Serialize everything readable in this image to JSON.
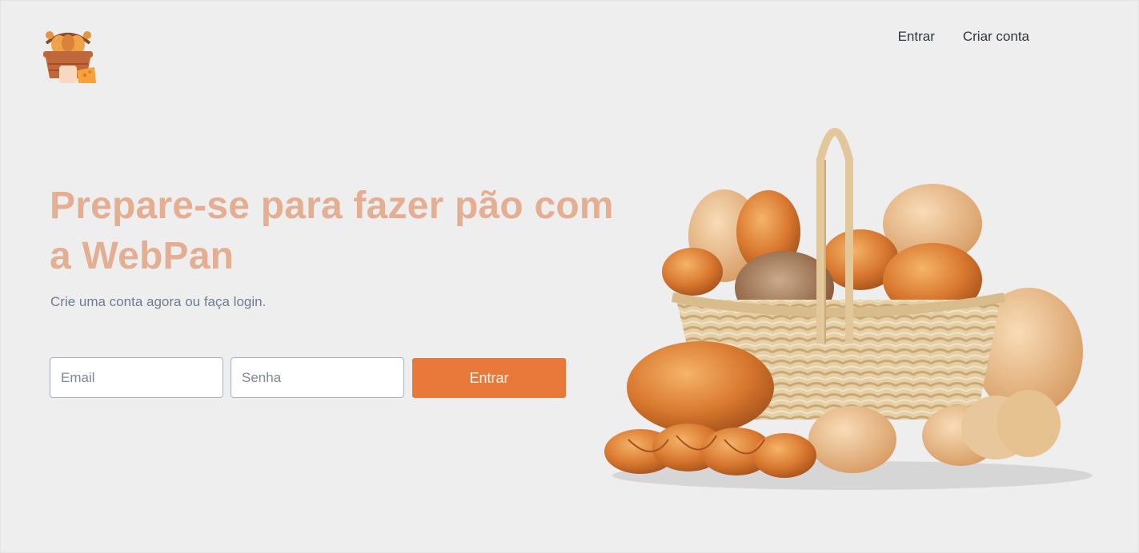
{
  "header": {
    "logo": "bread-basket-logo",
    "nav": [
      {
        "label": "Entrar"
      },
      {
        "label": "Criar conta"
      }
    ]
  },
  "hero": {
    "title": "Prepare-se para fazer pão com a WebPan",
    "subtitle": "Crie uma conta agora ou faça login.",
    "image": "bread-basket-image"
  },
  "login_form": {
    "email_placeholder": "Email",
    "email_value": "",
    "password_placeholder": "Senha",
    "password_value": "",
    "submit_label": "Entrar"
  },
  "colors": {
    "background": "#eeeeee",
    "title": "#e4ae92",
    "subtitle": "#6f7d92",
    "accent": "#e8793b",
    "nav_text": "#2f3640"
  }
}
